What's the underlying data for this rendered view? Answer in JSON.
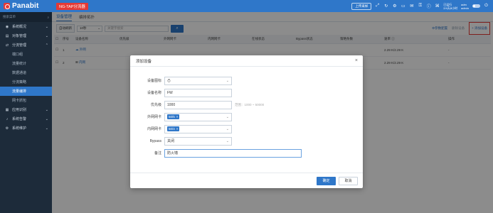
{
  "header": {
    "logo": "Panabit",
    "product_badge": "NG-TAP分流器",
    "upload_btn": "上传采样",
    "run_status": "已运行",
    "run_time": "2/4天8小时",
    "user": "adm",
    "role": "admin"
  },
  "sidebar": {
    "search_placeholder": "搜索菜单",
    "items": [
      {
        "label": "系统概况",
        "icon": "dashboard-icon"
      },
      {
        "label": "对象管理",
        "icon": "object-icon"
      },
      {
        "label": "分流管理",
        "icon": "split-icon"
      }
    ],
    "sub_items": [
      "端口组",
      "流量统计",
      "数据通道",
      "分流策略",
      "流量编排",
      "网卡抓包"
    ],
    "bottom_items": [
      {
        "label": "应用识别",
        "icon": "app-icon"
      },
      {
        "label": "系统告警",
        "icon": "bell-icon"
      },
      {
        "label": "系统维护",
        "icon": "tool-icon"
      }
    ]
  },
  "main": {
    "tabs": [
      "设备管理",
      "编排拓扑"
    ],
    "toolbar": {
      "auto_refresh": "自动刷新",
      "interval": "10秒",
      "keyword_placeholder": "关键字搜索",
      "param_config": "参数配置",
      "delete_device": "删除设备",
      "add_device": "+ 添加设备"
    },
    "columns": [
      "序号",
      "设备名称",
      "优先级",
      "外网网卡",
      "内网网卡",
      "在线状态",
      "Bypass状态",
      "策略条数",
      "速率 ⓘ",
      "操作"
    ],
    "rows": [
      {
        "idx": "1",
        "name": "外网",
        "rate": "2.29 K/2.29 K",
        "op": "-"
      },
      {
        "idx": "2",
        "name": "内网",
        "rate": "2.29 K/2.29 K",
        "op": "-"
      }
    ]
  },
  "modal": {
    "title": "添加设备",
    "fields": {
      "icon_label": "设备图标",
      "name_label": "设备名称",
      "name_value": "FW",
      "priority_label": "优先级",
      "priority_value": "1000",
      "priority_hint": "范围：1000 ~ 50000",
      "outer_label": "外网网卡",
      "outer_value": "50/5",
      "inner_label": "内网网卡",
      "inner_value": "50/4",
      "bypass_label": "Bypass",
      "bypass_value": "关闭",
      "note_label": "备注",
      "note_value": "防火墙"
    },
    "ok": "确定",
    "cancel": "取消"
  },
  "colors": {
    "accent": "#2f77c9",
    "sidebar": "#1d2b3a",
    "highlight": "#e53935"
  }
}
